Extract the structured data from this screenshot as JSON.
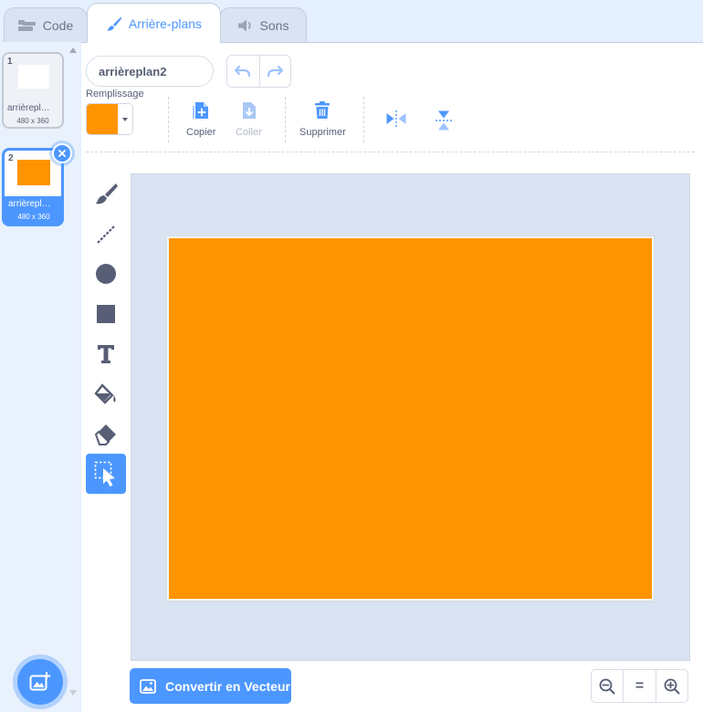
{
  "tabs": [
    {
      "label": "Code",
      "icon": "code-icon"
    },
    {
      "label": "Arrière-plans",
      "icon": "paintbrush-icon",
      "active": true
    },
    {
      "label": "Sons",
      "icon": "speaker-icon"
    }
  ],
  "backdrops": [
    {
      "number": "1",
      "name": "arrièrepl…",
      "size": "480 x 360",
      "thumb_color": "#ffffff",
      "selected": false
    },
    {
      "number": "2",
      "name": "arrièrepl…",
      "size": "480 x 360",
      "thumb_color": "#ff9400",
      "selected": true
    }
  ],
  "editor": {
    "costume_name": "arrièreplan2",
    "fill_label": "Remplissage",
    "fill_color": "#ff9400",
    "actions": {
      "copy": "Copier",
      "paste": "Coller",
      "delete": "Supprimer"
    },
    "convert_button": "Convertir en Vecteur",
    "zoom_reset": "="
  },
  "colors": {
    "accent": "#4c97ff",
    "canvas_fill": "#ff9400",
    "canvas_bg": "#d9e3f2"
  }
}
